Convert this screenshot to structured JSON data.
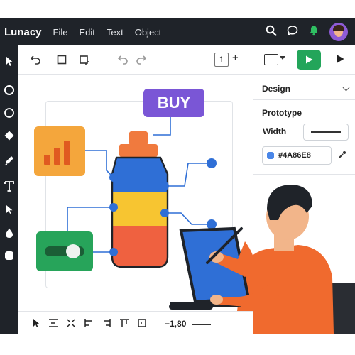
{
  "app": {
    "name": "Lunacy",
    "menu": [
      "File",
      "Edit",
      "Text",
      "Object"
    ]
  },
  "toolbar": {
    "page_number": "1",
    "add_page": "+"
  },
  "right_panel": {
    "design_title": "Design",
    "prototype_title": "Prototype",
    "width_label": "Width",
    "fill_color_hex": "#4A86E8"
  },
  "canvas": {
    "buy_label": "BUY",
    "toggle_on": true
  },
  "bottom_bar": {
    "zoom_label": "−1,80"
  },
  "colors": {
    "chrome": "#1f2329",
    "accent_green": "#23a55a",
    "buy_purple": "#7a56d6",
    "chart_orange": "#f4a63c",
    "connector_blue": "#2f6fd6",
    "fill_swatch": "#4A86E8"
  },
  "icons": {
    "left_tools": [
      "cursor-icon",
      "circle-icon",
      "circle-outline-icon",
      "diamond-icon",
      "pen-icon",
      "text-icon",
      "pointer-icon",
      "drop-icon",
      "rounded-square-icon"
    ],
    "top_tools": [
      "undo-icon",
      "square-icon",
      "crop-icon",
      "undo-light-icon",
      "redo-light-icon"
    ],
    "header_right": [
      "search-icon",
      "comment-icon",
      "notification-bell-icon",
      "avatar"
    ]
  }
}
